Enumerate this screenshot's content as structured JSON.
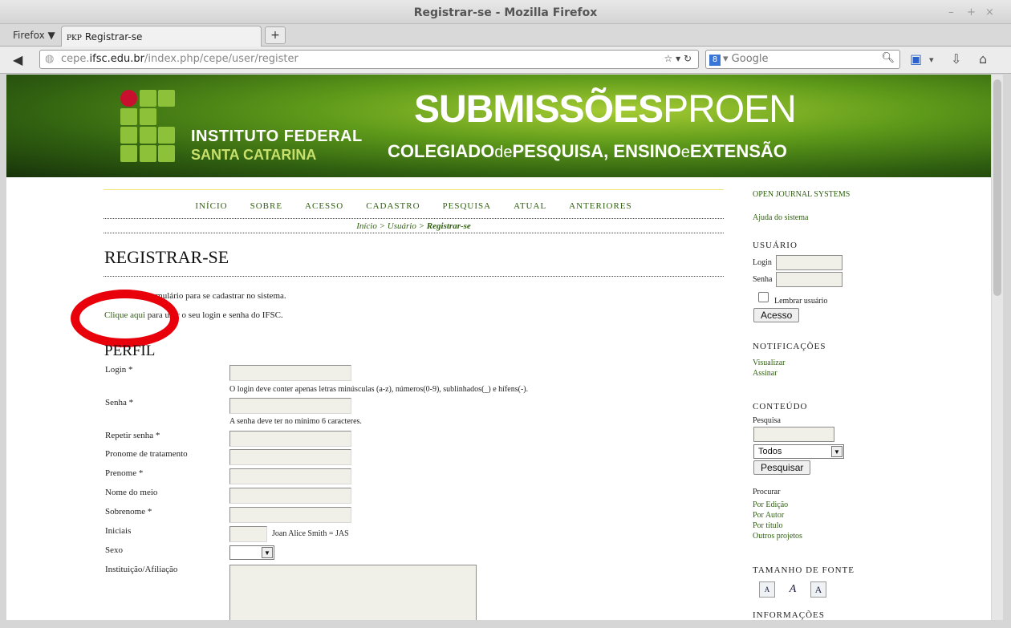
{
  "window": {
    "title": "Registrar-se - Mozilla Firefox",
    "controls": [
      "–",
      "+",
      "×"
    ]
  },
  "browser": {
    "menu_label": "Firefox ▼",
    "tab": {
      "favicon": "PKP",
      "label": "Registrar-se"
    },
    "newtab_label": "+",
    "url": {
      "prefix": "cepe.",
      "host": "ifsc.edu.br",
      "path": "/index.php/cepe/user/register"
    },
    "search_placeholder": "Google",
    "search_engine": "8"
  },
  "banner": {
    "inst_line1": "INSTITUTO FEDERAL",
    "inst_line2": "SANTA CATARINA",
    "title_bold": "SUBMISSÕES",
    "title_light": "PROEN",
    "sub_1": "COLEGIADO",
    "sub_2": "de",
    "sub_3": "PESQUISA, ENSINO",
    "sub_4": "e",
    "sub_5": "EXTENSÃO"
  },
  "nav": {
    "items": [
      "INÍCIO",
      "SOBRE",
      "ACESSO",
      "CADASTRO",
      "PESQUISA",
      "ATUAL",
      "ANTERIORES"
    ]
  },
  "breadcrumb": {
    "home": "Início",
    "sep": ">",
    "user": "Usuário",
    "current": "Registrar-se"
  },
  "page": {
    "title": "REGISTRAR-SE",
    "intro": "Preencha o formulário para se cadastrar no sistema.",
    "clique_link": "Clique aqui",
    "clique_rest": " para usar o seu login e senha do IFSC.",
    "section": "PERFIL"
  },
  "form": {
    "login_label": "Login *",
    "login_help": "O login deve conter apenas letras minúsculas (a-z), números(0-9), sublinhados(_) e hífens(-).",
    "senha_label": "Senha *",
    "senha_help": "A senha deve ter no mínimo 6 caracteres.",
    "repetir_label": "Repetir senha *",
    "pronome_label": "Pronome de tratamento",
    "prenome_label": "Prenome *",
    "nome_meio_label": "Nome do meio",
    "sobrenome_label": "Sobrenome *",
    "iniciais_label": "Iniciais",
    "iniciais_help": "Joan Alice Smith = JAS",
    "sexo_label": "Sexo",
    "sexo_value": "",
    "instituicao_label": "Instituição/Afiliação"
  },
  "sidebar": {
    "ojs": "OPEN JOURNAL SYSTEMS",
    "help": "Ajuda do sistema",
    "usuario_head": "USUÁRIO",
    "login_label": "Login",
    "senha_label": "Senha",
    "remember": "Lembrar usuário",
    "acesso_btn": "Acesso",
    "notif_head": "NOTIFICAÇÕES",
    "visualizar": "Visualizar",
    "assinar": "Assinar",
    "conteudo_head": "CONTEÚDO",
    "pesquisa_label": "Pesquisa",
    "scope_value": "Todos",
    "pesquisar_btn": "Pesquisar",
    "procurar": "Procurar",
    "por_edicao": "Por Edição",
    "por_autor": "Por Autor",
    "por_titulo": "Por título",
    "outros": "Outros projetos",
    "fonte_head": "TAMANHO DE FONTE",
    "font_small": "A",
    "font_mid": "A",
    "font_big": "A",
    "info_head": "INFORMAÇÕES"
  },
  "colors": {
    "link_green": "#2f5f10",
    "accent_red": "#e8000b",
    "logo_green": "#8ec13a"
  }
}
